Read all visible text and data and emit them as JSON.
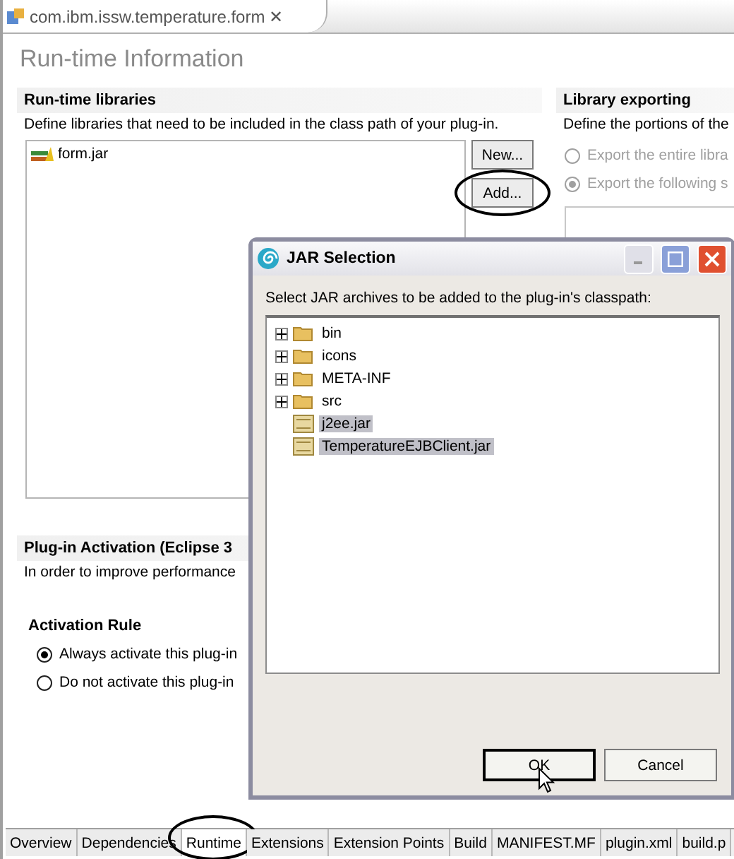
{
  "editor_tab": {
    "title": "com.ibm.issw.temperature.form",
    "close": "✕"
  },
  "page_title": "Run-time Information",
  "libraries": {
    "heading": "Run-time libraries",
    "description": "Define libraries that need to be included in the class path of your plug-in.",
    "items": [
      {
        "name": "form.jar"
      }
    ],
    "buttons": [
      {
        "label": "New...",
        "annotated": false
      },
      {
        "label": "Add...",
        "annotated": true
      }
    ]
  },
  "exporting": {
    "heading": "Library exporting",
    "description": "Define the portions of the",
    "options": [
      {
        "label": "Export the entire libra",
        "selected": false,
        "disabled": true
      },
      {
        "label": "Export the following s",
        "selected": true,
        "disabled": true
      }
    ]
  },
  "activation": {
    "heading": "Plug-in Activation (Eclipse 3",
    "description": "In order to improve performance",
    "rule_heading": "Activation Rule",
    "options": [
      {
        "label": "Always activate this plug-in",
        "selected": true
      },
      {
        "label": "Do not activate this plug-in",
        "selected": false
      }
    ]
  },
  "dialog": {
    "title": "JAR Selection",
    "message": "Select JAR archives to be added to the plug-in's classpath:",
    "tree": [
      {
        "name": "bin",
        "kind": "folder",
        "selected": false
      },
      {
        "name": "icons",
        "kind": "folder",
        "selected": false
      },
      {
        "name": "META-INF",
        "kind": "folder",
        "selected": false
      },
      {
        "name": "src",
        "kind": "folder",
        "selected": false
      },
      {
        "name": "j2ee.jar",
        "kind": "jar",
        "selected": true
      },
      {
        "name": "TemperatureEJBClient.jar",
        "kind": "jar",
        "selected": true
      }
    ],
    "buttons": [
      {
        "label": "OK",
        "default": true
      },
      {
        "label": "Cancel",
        "default": false
      }
    ]
  },
  "page_tabs": [
    {
      "label": "Overview",
      "selected": false,
      "annotated": false
    },
    {
      "label": "Dependencies",
      "selected": false,
      "annotated": false
    },
    {
      "label": "Runtime",
      "selected": true,
      "annotated": true
    },
    {
      "label": "Extensions",
      "selected": false,
      "annotated": false
    },
    {
      "label": "Extension Points",
      "selected": false,
      "annotated": false
    },
    {
      "label": "Build",
      "selected": false,
      "annotated": false
    },
    {
      "label": "MANIFEST.MF",
      "selected": false,
      "annotated": false
    },
    {
      "label": "plugin.xml",
      "selected": false,
      "annotated": false
    },
    {
      "label": "build.p",
      "selected": false,
      "annotated": false
    }
  ]
}
